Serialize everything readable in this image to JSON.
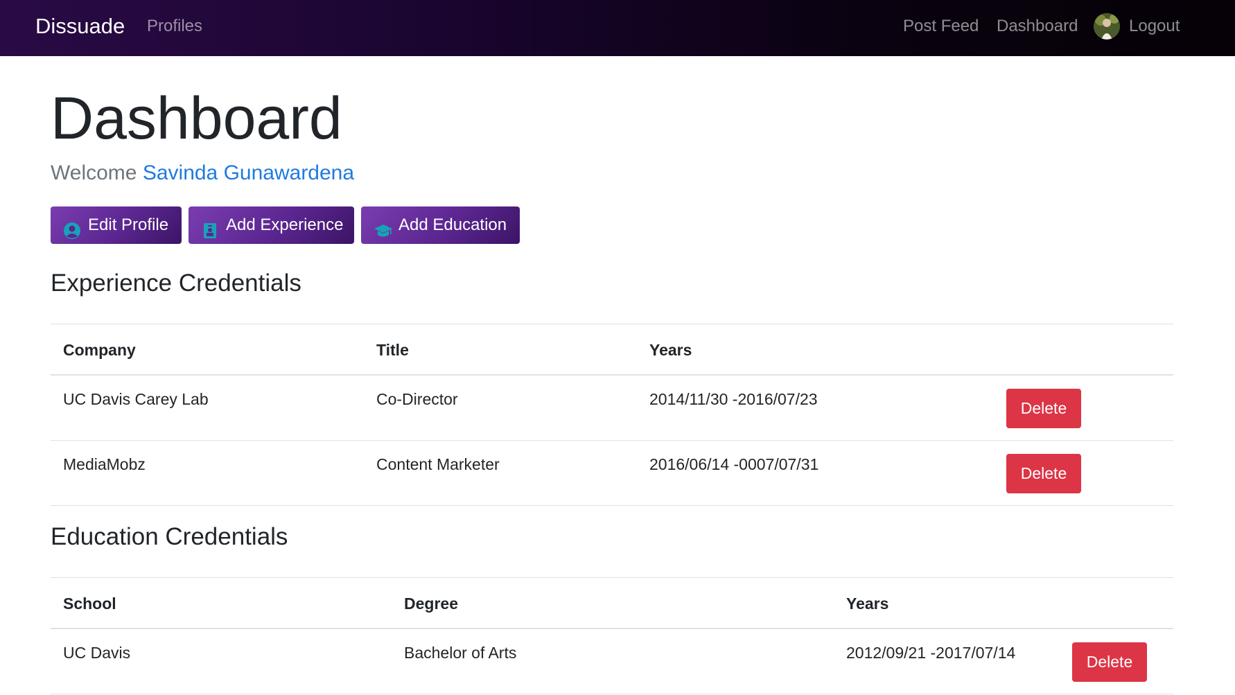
{
  "navbar": {
    "brand": "Dissuade",
    "profiles_label": "Profiles",
    "post_feed_label": "Post Feed",
    "dashboard_label": "Dashboard",
    "logout_label": "Logout"
  },
  "page": {
    "title": "Dashboard",
    "welcome_prefix": "Welcome",
    "user_name": "Savinda Gunawardena"
  },
  "actions": {
    "edit_profile_label": "Edit Profile",
    "add_experience_label": "Add Experience",
    "add_education_label": "Add Education",
    "edit_profile_icon": "user-circle-icon",
    "add_experience_icon": "id-badge-icon",
    "add_education_icon": "graduation-cap-icon"
  },
  "experience": {
    "title": "Experience Credentials",
    "headers": [
      "Company",
      "Title",
      "Years"
    ],
    "rows": [
      {
        "company": "UC Davis Carey Lab",
        "title": "Co-Director",
        "years": "2014/11/30 -2016/07/23",
        "delete_label": "Delete"
      },
      {
        "company": "MediaMobz",
        "title": "Content Marketer",
        "years": "2016/06/14 -0007/07/31",
        "delete_label": "Delete"
      }
    ]
  },
  "education": {
    "title": "Education Credentials",
    "headers": [
      "School",
      "Degree",
      "Years"
    ],
    "rows": [
      {
        "school": "UC Davis",
        "degree": "Bachelor of Arts",
        "years": "2012/09/21 -2017/07/14",
        "delete_label": "Delete"
      }
    ]
  },
  "colors": {
    "navbar_start": "#2a0a45",
    "navbar_end": "#050106",
    "button_purple": "#5b2690",
    "link_blue": "#1f7ae0",
    "delete_red": "#dc3545",
    "icon_cyan": "#17a2b8"
  }
}
